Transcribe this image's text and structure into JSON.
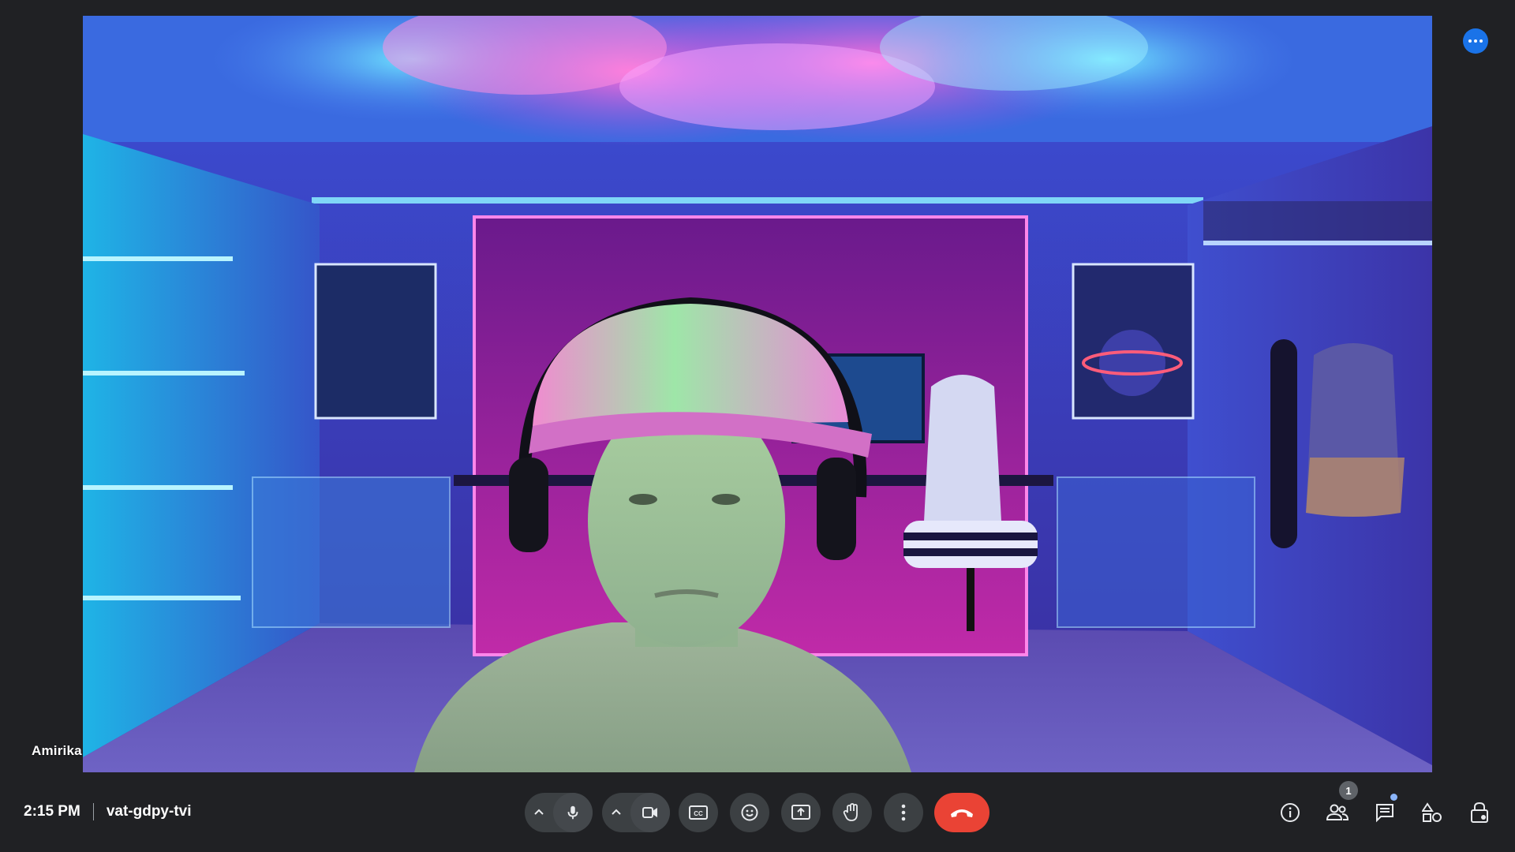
{
  "meeting": {
    "time": "2:15 PM",
    "code": "vat-gdpy-tvi"
  },
  "participant": {
    "name": "Amirika"
  },
  "participants_count": "1",
  "icons": {
    "more_options": "three-dots-icon",
    "mic": "microphone-icon",
    "camera": "videocam-icon",
    "captions": "closed-captions-icon",
    "reactions": "emoji-icon",
    "present": "present-screen-icon",
    "raise_hand": "raise-hand-icon",
    "more_vert": "more-vert-icon",
    "end_call": "call-end-icon",
    "info": "info-icon",
    "people": "people-icon",
    "chat": "chat-icon",
    "activities": "activities-icon",
    "host_controls": "host-controls-lock-icon"
  },
  "colors": {
    "background": "#202124",
    "button": "#3c4043",
    "end_call": "#ea4335",
    "accent": "#1a73e8"
  }
}
